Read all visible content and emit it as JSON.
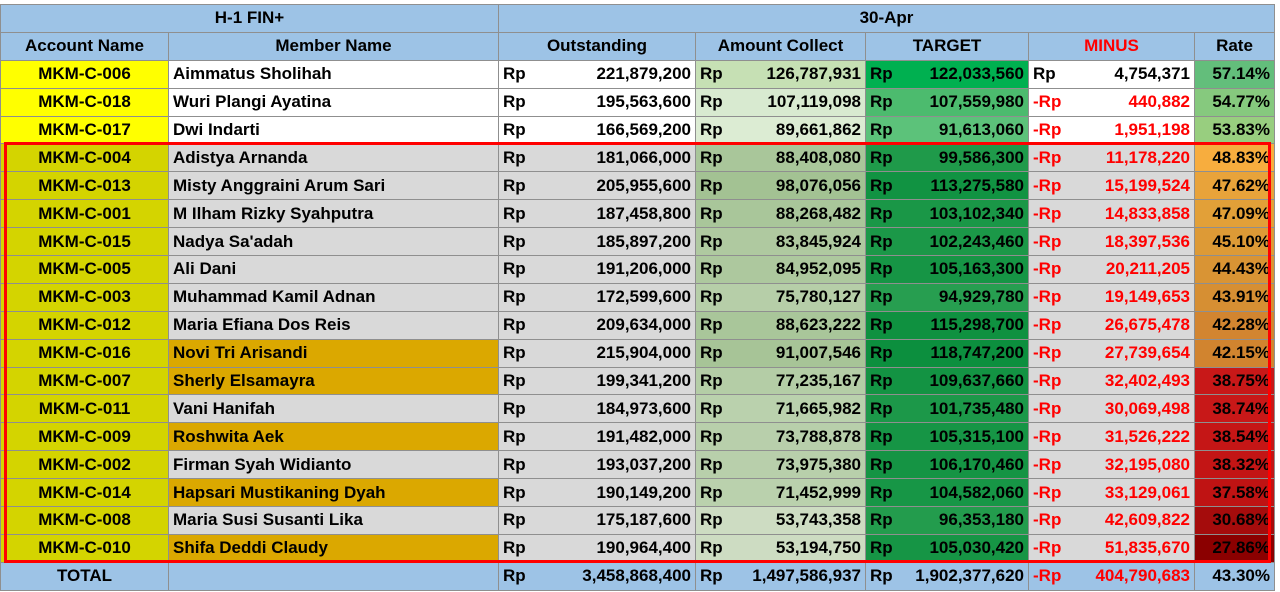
{
  "header": {
    "group_left": "H-1 FIN+",
    "group_right": "30-Apr",
    "columns": [
      "Account Name",
      "Member Name",
      "Outstanding",
      "Amount Collect",
      "TARGET",
      "MINUS",
      "Rate"
    ]
  },
  "currency": "Rp",
  "minus_prefix": "-Rp",
  "rows": [
    {
      "account": "MKM-C-006",
      "member": "Aimmatus Sholihah",
      "outstanding": "221,879,200",
      "collect": "126,787,931",
      "target": "122,033,560",
      "minus": "4,754,371",
      "negative": false,
      "rate": "57.14%",
      "acct_bg": "#ffff00",
      "member_bg": "#ffffff",
      "out_bg": "#ffffff",
      "col_bg": "#c6e0b4",
      "tgt_bg": "#00b050",
      "min_bg": "#ffffff",
      "rate_bg": "#63be7b"
    },
    {
      "account": "MKM-C-018",
      "member": "Wuri Plangi Ayatina",
      "outstanding": "195,563,600",
      "collect": "107,119,098",
      "target": "107,559,980",
      "minus": "440,882",
      "negative": true,
      "rate": "54.77%",
      "acct_bg": "#ffff00",
      "member_bg": "#ffffff",
      "out_bg": "#ffffff",
      "col_bg": "#d8ead0",
      "tgt_bg": "#4cbb6e",
      "min_bg": "#ffffff",
      "rate_bg": "#86c97e"
    },
    {
      "account": "MKM-C-017",
      "member": "Dwi Indarti",
      "outstanding": "166,569,200",
      "collect": "89,661,862",
      "target": "91,613,060",
      "minus": "1,951,198",
      "negative": true,
      "rate": "53.83%",
      "acct_bg": "#ffff00",
      "member_bg": "#ffffff",
      "out_bg": "#ffffff",
      "col_bg": "#dcecd3",
      "tgt_bg": "#5cc27a",
      "min_bg": "#ffffff",
      "rate_bg": "#98ce7f"
    },
    {
      "account": "MKM-C-004",
      "member": "Adistya Arnanda",
      "outstanding": "181,066,000",
      "collect": "88,408,080",
      "target": "99,586,300",
      "minus": "11,178,220",
      "negative": true,
      "rate": "48.83%",
      "acct_bg": "#d4d400",
      "member_bg": "#d9d9d9",
      "out_bg": "#d9d9d9",
      "col_bg": "#a9c69a",
      "tgt_bg": "#1f9a4a",
      "min_bg": "#d9d9d9",
      "rate_bg": "#f7ad3e"
    },
    {
      "account": "MKM-C-013",
      "member": "Misty Anggraini Arum Sari",
      "outstanding": "205,955,600",
      "collect": "98,076,056",
      "target": "113,275,580",
      "minus": "15,199,524",
      "negative": true,
      "rate": "47.62%",
      "acct_bg": "#d4d400",
      "member_bg": "#d9d9d9",
      "out_bg": "#d9d9d9",
      "col_bg": "#a3c293",
      "tgt_bg": "#119342",
      "min_bg": "#d9d9d9",
      "rate_bg": "#e8a33a"
    },
    {
      "account": "MKM-C-001",
      "member": "M Ilham Rizky Syahputra",
      "outstanding": "187,458,800",
      "collect": "88,268,482",
      "target": "103,102,340",
      "minus": "14,833,858",
      "negative": true,
      "rate": "47.09%",
      "acct_bg": "#d4d400",
      "member_bg": "#d9d9d9",
      "out_bg": "#d9d9d9",
      "col_bg": "#a9c69a",
      "tgt_bg": "#1a9747",
      "min_bg": "#d9d9d9",
      "rate_bg": "#e2a038"
    },
    {
      "account": "MKM-C-015",
      "member": "Nadya Sa'adah",
      "outstanding": "185,897,200",
      "collect": "83,845,924",
      "target": "102,243,460",
      "minus": "18,397,536",
      "negative": true,
      "rate": "45.10%",
      "acct_bg": "#d4d400",
      "member_bg": "#d9d9d9",
      "out_bg": "#d9d9d9",
      "col_bg": "#afc9a0",
      "tgt_bg": "#1b9848",
      "min_bg": "#d9d9d9",
      "rate_bg": "#dd9a36"
    },
    {
      "account": "MKM-C-005",
      "member": "Ali Dani",
      "outstanding": "191,206,000",
      "collect": "84,952,095",
      "target": "105,163,300",
      "minus": "20,211,205",
      "negative": true,
      "rate": "44.43%",
      "acct_bg": "#d4d400",
      "member_bg": "#d9d9d9",
      "out_bg": "#d9d9d9",
      "col_bg": "#adc89e",
      "tgt_bg": "#169545",
      "min_bg": "#d9d9d9",
      "rate_bg": "#d99434"
    },
    {
      "account": "MKM-C-003",
      "member": "Muhammad Kamil Adnan",
      "outstanding": "172,599,600",
      "collect": "75,780,127",
      "target": "94,929,780",
      "minus": "19,149,653",
      "negative": true,
      "rate": "43.91%",
      "acct_bg": "#d4d400",
      "member_bg": "#d9d9d9",
      "out_bg": "#d9d9d9",
      "col_bg": "#b6cea8",
      "tgt_bg": "#279e50",
      "min_bg": "#d9d9d9",
      "rate_bg": "#d68f33"
    },
    {
      "account": "MKM-C-012",
      "member": "Maria Efiana Dos Reis",
      "outstanding": "209,634,000",
      "collect": "88,623,222",
      "target": "115,298,700",
      "minus": "26,675,478",
      "negative": true,
      "rate": "42.28%",
      "acct_bg": "#d4d400",
      "member_bg": "#d9d9d9",
      "out_bg": "#d9d9d9",
      "col_bg": "#a9c69a",
      "tgt_bg": "#0f9140",
      "min_bg": "#d9d9d9",
      "rate_bg": "#d28530"
    },
    {
      "account": "MKM-C-016",
      "member": "Novi Tri Arisandi",
      "outstanding": "215,904,000",
      "collect": "91,007,546",
      "target": "118,747,200",
      "minus": "27,739,654",
      "negative": true,
      "rate": "42.15%",
      "acct_bg": "#d4d400",
      "member_bg": "#dba800",
      "out_bg": "#d9d9d9",
      "col_bg": "#a7c497",
      "tgt_bg": "#0c8f3e",
      "min_bg": "#d9d9d9",
      "rate_bg": "#d1842f"
    },
    {
      "account": "MKM-C-007",
      "member": "Sherly Elsamayra",
      "outstanding": "199,341,200",
      "collect": "77,235,167",
      "target": "109,637,660",
      "minus": "32,402,493",
      "negative": true,
      "rate": "38.75%",
      "acct_bg": "#d4d400",
      "member_bg": "#dba800",
      "out_bg": "#d9d9d9",
      "col_bg": "#b4cda6",
      "tgt_bg": "#139343",
      "min_bg": "#d9d9d9",
      "rate_bg": "#c81818"
    },
    {
      "account": "MKM-C-011",
      "member": "Vani Hanifah",
      "outstanding": "184,973,600",
      "collect": "71,665,982",
      "target": "101,735,480",
      "minus": "30,069,498",
      "negative": true,
      "rate": "38.74%",
      "acct_bg": "#d4d400",
      "member_bg": "#d9d9d9",
      "out_bg": "#d9d9d9",
      "col_bg": "#bad1ad",
      "tgt_bg": "#1c9849",
      "min_bg": "#d9d9d9",
      "rate_bg": "#c81818"
    },
    {
      "account": "MKM-C-009",
      "member": "Roshwita Aek",
      "outstanding": "191,482,000",
      "collect": "73,788,878",
      "target": "105,315,100",
      "minus": "31,526,222",
      "negative": true,
      "rate": "38.54%",
      "acct_bg": "#d4d400",
      "member_bg": "#dba800",
      "out_bg": "#d9d9d9",
      "col_bg": "#b8cfab",
      "tgt_bg": "#169545",
      "min_bg": "#d9d9d9",
      "rate_bg": "#c51616"
    },
    {
      "account": "MKM-C-002",
      "member": "Firman Syah Widianto",
      "outstanding": "193,037,200",
      "collect": "73,975,380",
      "target": "106,170,460",
      "minus": "32,195,080",
      "negative": true,
      "rate": "38.32%",
      "acct_bg": "#d4d400",
      "member_bg": "#d9d9d9",
      "out_bg": "#d9d9d9",
      "col_bg": "#b8cfab",
      "tgt_bg": "#159444",
      "min_bg": "#d9d9d9",
      "rate_bg": "#c31515"
    },
    {
      "account": "MKM-C-014",
      "member": "Hapsari Mustikaning Dyah",
      "outstanding": "190,149,200",
      "collect": "71,452,999",
      "target": "104,582,060",
      "minus": "33,129,061",
      "negative": true,
      "rate": "37.58%",
      "acct_bg": "#d4d400",
      "member_bg": "#dba800",
      "out_bg": "#d9d9d9",
      "col_bg": "#bad1ad",
      "tgt_bg": "#179646",
      "min_bg": "#d9d9d9",
      "rate_bg": "#bf1313"
    },
    {
      "account": "MKM-C-008",
      "member": "Maria Susi Susanti Lika",
      "outstanding": "175,187,600",
      "collect": "53,743,358",
      "target": "96,353,180",
      "minus": "42,609,822",
      "negative": true,
      "rate": "30.68%",
      "acct_bg": "#d4d400",
      "member_bg": "#d9d9d9",
      "out_bg": "#d9d9d9",
      "col_bg": "#cddcc2",
      "tgt_bg": "#239c4d",
      "min_bg": "#d9d9d9",
      "rate_bg": "#a50c0c"
    },
    {
      "account": "MKM-C-010",
      "member": "Shifa Deddi Claudy",
      "outstanding": "190,964,400",
      "collect": "53,194,750",
      "target": "105,030,420",
      "minus": "51,835,670",
      "negative": true,
      "rate": "27.86%",
      "acct_bg": "#d4d400",
      "member_bg": "#dba800",
      "out_bg": "#d9d9d9",
      "col_bg": "#cddcc2",
      "tgt_bg": "#169545",
      "min_bg": "#d9d9d9",
      "rate_bg": "#8b0000"
    }
  ],
  "total": {
    "label": "TOTAL",
    "outstanding": "3,458,868,400",
    "collect": "1,497,586,937",
    "target": "1,902,377,620",
    "minus": "404,790,683",
    "rate": "43.30%"
  },
  "colors": {
    "header_bg": "#9dc3e6",
    "minus_header_text": "#ff0000",
    "negative_text": "#ff0000",
    "highlight_border": "#ff0000"
  }
}
